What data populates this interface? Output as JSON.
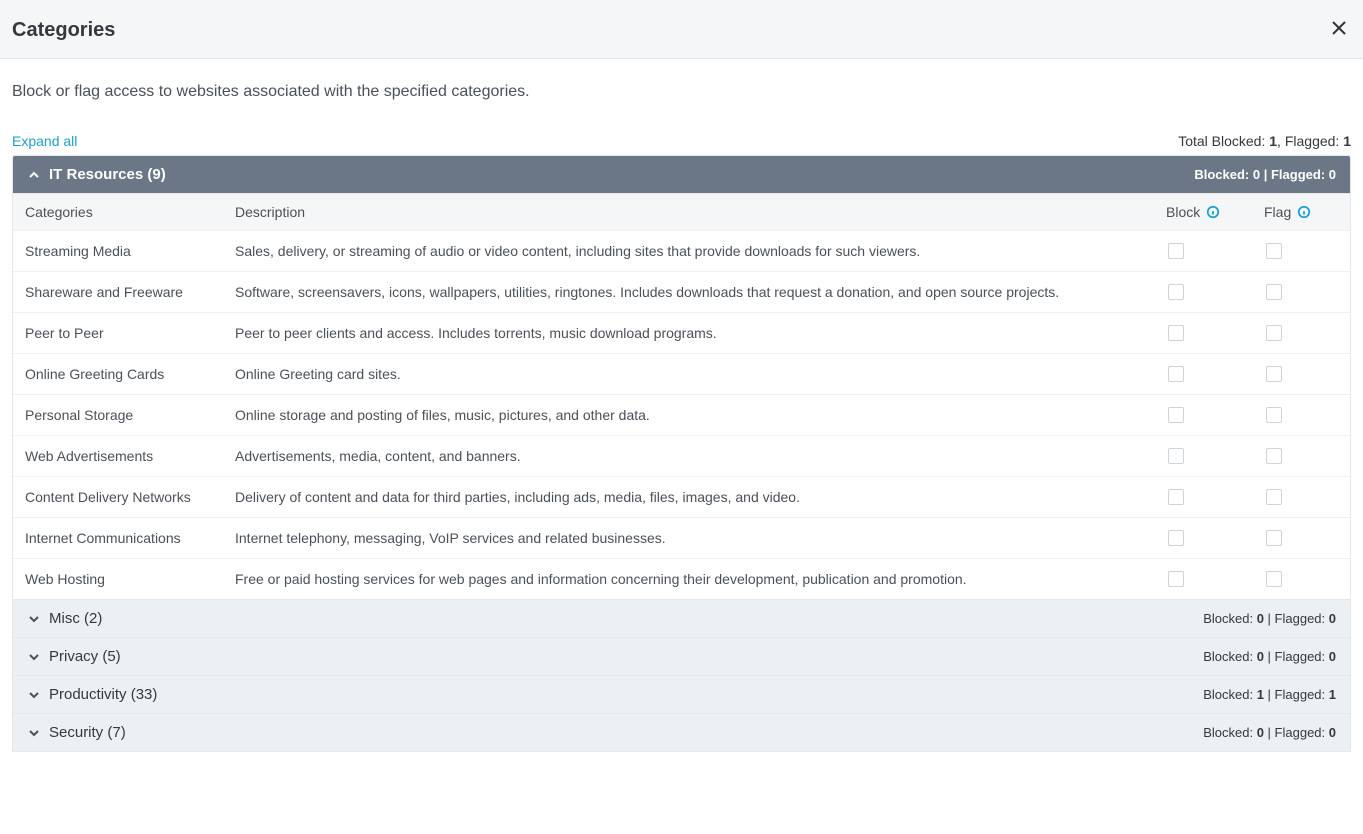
{
  "header": {
    "title": "Categories"
  },
  "intro": "Block or flag access to websites associated with the specified categories.",
  "expand_all_label": "Expand all",
  "totals": {
    "blocked_label": "Total Blocked:",
    "blocked_value": "1",
    "separator": ", ",
    "flagged_label": "Flagged:",
    "flagged_value": "1"
  },
  "group_summary_tpl": {
    "blocked_label": "Blocked:",
    "flagged_label": "Flagged:",
    "sep": " | "
  },
  "columns": {
    "categories": "Categories",
    "description": "Description",
    "block": "Block",
    "flag": "Flag"
  },
  "groups": {
    "it_resources": {
      "title": "IT Resources (9)",
      "expanded": true,
      "blocked": "0",
      "flagged": "0",
      "rows": [
        {
          "category": "Streaming Media",
          "description": "Sales, delivery, or streaming of audio or video content, including sites that provide downloads for such viewers.",
          "block": false,
          "flag": false
        },
        {
          "category": "Shareware and Freeware",
          "description": "Software, screensavers, icons, wallpapers, utilities, ringtones. Includes downloads that request a donation, and open source projects.",
          "block": false,
          "flag": false
        },
        {
          "category": "Peer to Peer",
          "description": "Peer to peer clients and access. Includes torrents, music download programs.",
          "block": false,
          "flag": false
        },
        {
          "category": "Online Greeting Cards",
          "description": "Online Greeting card sites.",
          "block": false,
          "flag": false
        },
        {
          "category": "Personal Storage",
          "description": "Online storage and posting of files, music, pictures, and other data.",
          "block": false,
          "flag": false
        },
        {
          "category": "Web Advertisements",
          "description": "Advertisements, media, content, and banners.",
          "block": false,
          "flag": false
        },
        {
          "category": "Content Delivery Networks",
          "description": "Delivery of content and data for third parties, including ads, media, files, images, and video.",
          "block": false,
          "flag": false
        },
        {
          "category": "Internet Communications",
          "description": "Internet telephony, messaging, VoIP services and related businesses.",
          "block": false,
          "flag": false
        },
        {
          "category": "Web Hosting",
          "description": "Free or paid hosting services for web pages and information concerning their development, publication and promotion.",
          "block": false,
          "flag": false
        }
      ]
    },
    "misc": {
      "title": "Misc (2)",
      "expanded": false,
      "blocked": "0",
      "flagged": "0"
    },
    "privacy": {
      "title": "Privacy (5)",
      "expanded": false,
      "blocked": "0",
      "flagged": "0"
    },
    "productivity": {
      "title": "Productivity (33)",
      "expanded": false,
      "blocked": "1",
      "flagged": "1"
    },
    "security": {
      "title": "Security (7)",
      "expanded": false,
      "blocked": "0",
      "flagged": "0"
    }
  }
}
